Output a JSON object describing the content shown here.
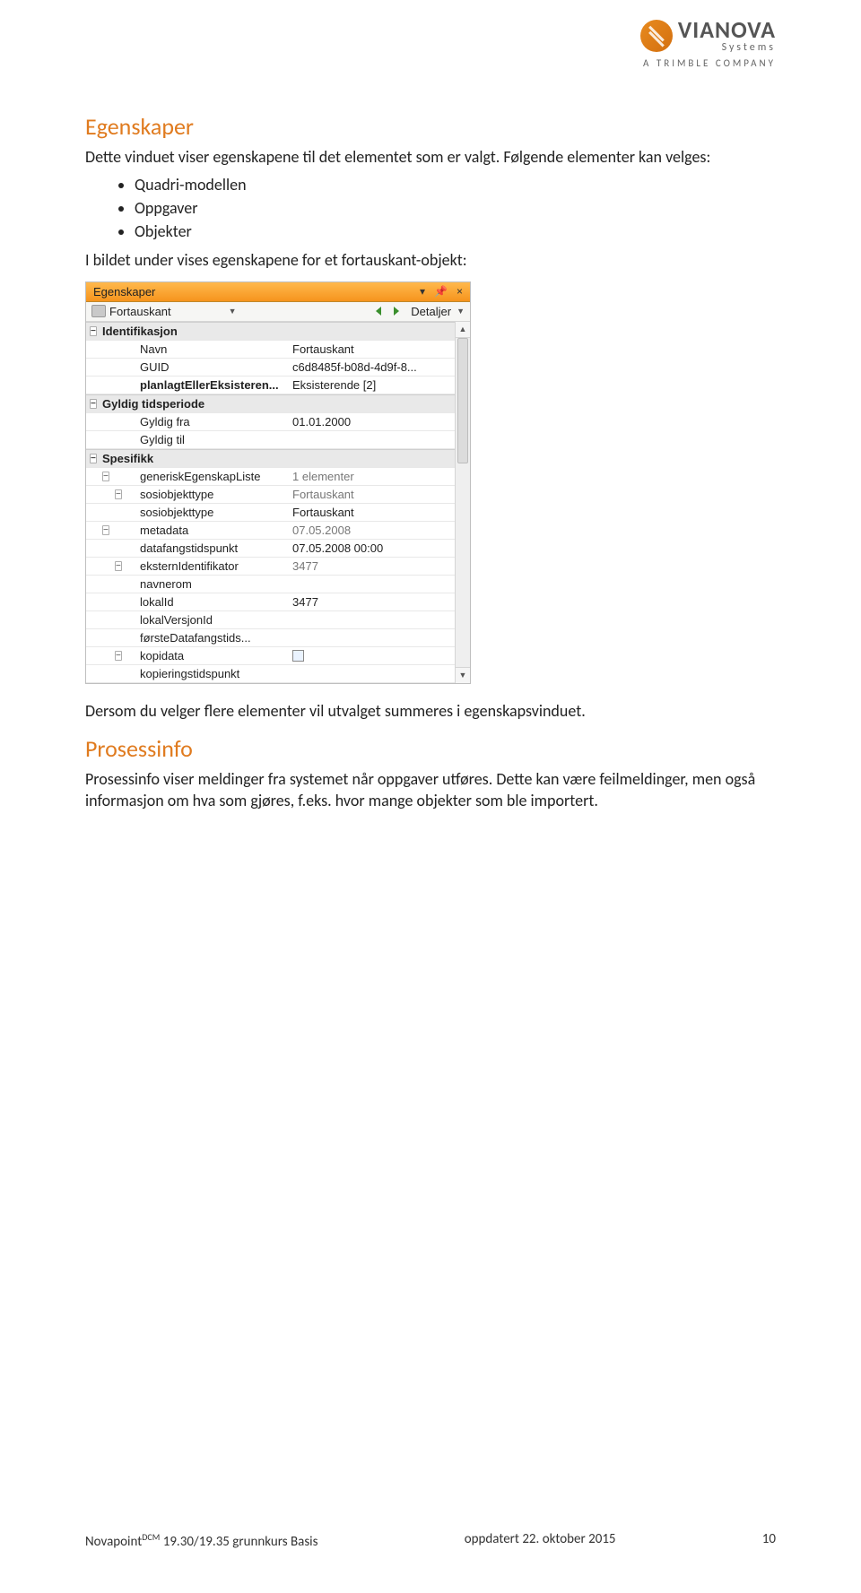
{
  "logo": {
    "name": "VIANOVA",
    "sub": "Systems",
    "tagline": "A  TRIMBLE  COMPANY"
  },
  "section1": {
    "heading": "Egenskaper",
    "para1": "Dette vinduet viser egenskapene til det elementet som er valgt. Følgende elementer kan velges:",
    "bullets": [
      "Quadri-modellen",
      "Oppgaver",
      "Objekter"
    ],
    "para2": "I bildet under vises egenskapene for et fortauskant-objekt:",
    "para3": "Dersom du velger flere elementer vil utvalget summeres i egenskapsvinduet."
  },
  "section2": {
    "heading": "Prosessinfo",
    "para": "Prosessinfo viser meldinger fra systemet når oppgaver utføres. Dette kan være feilmeldinger, men også informasjon om hva som gjøres, f.eks. hvor mange objekter som ble importert."
  },
  "panel": {
    "title": "Egenskaper",
    "pin": "⯐",
    "close": "×",
    "menu_arrow": "▾",
    "object_name": "Fortauskant",
    "detaljer": "Detaljer",
    "groups": {
      "ident": "Identifikasjon",
      "tid": "Gyldig tidsperiode",
      "spes": "Spesifikk"
    },
    "rows": {
      "navn_l": "Navn",
      "navn_v": "Fortauskant",
      "guid_l": "GUID",
      "guid_v": "c6d8485f-b08d-4d9f-8...",
      "plan_l": "planlagtEllerEksisteren...",
      "plan_v": "Eksisterende [2]",
      "gfra_l": "Gyldig fra",
      "gfra_v": "01.01.2000",
      "gtil_l": "Gyldig til",
      "gtil_v": "",
      "gen_l": "generiskEgenskapListe",
      "gen_v": "1 elementer",
      "sot_l": "sosiobjekttype",
      "sot_v": "Fortauskant",
      "sot2_l": "sosiobjekttype",
      "sot2_v": "Fortauskant",
      "meta_l": "metadata",
      "meta_v": "07.05.2008",
      "dft_l": "datafangstidspunkt",
      "dft_v": "07.05.2008 00:00",
      "eks_l": "eksternIdentifikator",
      "eks_v": "3477",
      "nav_l": "navnerom",
      "nav_v": "",
      "lok_l": "lokalId",
      "lok_v": "3477",
      "lvi_l": "lokalVersjonId",
      "lvi_v": "",
      "fdt_l": "førsteDatafangstids...",
      "fdt_v": "",
      "kop_l": "kopidata",
      "kop_v": "",
      "ktp_l": "kopieringstidspunkt",
      "ktp_v": ""
    }
  },
  "footer": {
    "left_pre": "Novapoint",
    "left_sup": "DCM",
    "left_post": " 19.30/19.35 grunnkurs Basis",
    "center": "oppdatert 22. oktober 2015",
    "page": "10"
  }
}
